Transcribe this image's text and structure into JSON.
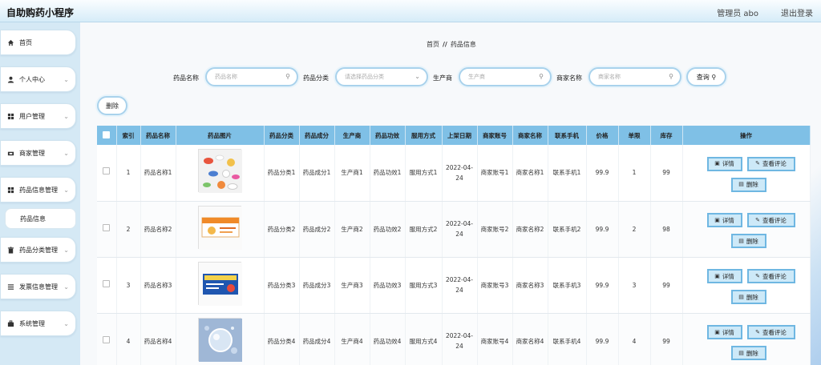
{
  "header": {
    "title": "自助购药小程序",
    "admin": "管理员 abo",
    "logout": "退出登录"
  },
  "sidebar": {
    "items": [
      {
        "label": "首页",
        "icon": "home-icon",
        "chevron": false
      },
      {
        "label": "个人中心",
        "icon": "user-icon",
        "chevron": true
      },
      {
        "label": "用户管理",
        "icon": "grid-icon",
        "chevron": true
      },
      {
        "label": "商家管理",
        "icon": "store-icon",
        "chevron": true
      },
      {
        "label": "药品信息管理",
        "icon": "grid-icon",
        "chevron": true
      },
      {
        "label": "药品分类管理",
        "icon": "trash-icon",
        "chevron": true
      },
      {
        "label": "发票信息管理",
        "icon": "list-icon",
        "chevron": true
      },
      {
        "label": "系统管理",
        "icon": "briefcase-icon",
        "chevron": true
      }
    ],
    "submenu": "药品信息"
  },
  "breadcrumb": {
    "home": "首页",
    "separator": "//",
    "current": "药品信息"
  },
  "search": {
    "name_label": "药品名称",
    "name_placeholder": "药品名称",
    "category_label": "药品分类",
    "category_placeholder": "请选择药品分类",
    "maker_label": "生产商",
    "maker_placeholder": "生产商",
    "merchant_label": "商家名称",
    "merchant_placeholder": "商家名称",
    "query_label": "查询"
  },
  "toolbar": {
    "delete_label": "删除"
  },
  "table": {
    "headers": [
      "索引",
      "药品名称",
      "药品图片",
      "药品分类",
      "药品成分",
      "生产商",
      "药品功效",
      "服用方式",
      "上架日期",
      "商家账号",
      "商家名称",
      "联系手机",
      "价格",
      "单限",
      "库存",
      "操作"
    ],
    "rows": [
      {
        "index": "1",
        "name": "药品名称1",
        "category": "药品分类1",
        "ingredient": "药品成分1",
        "maker": "生产商1",
        "effect": "药品功效1",
        "usage": "服用方式1",
        "date": "2022-04-24",
        "account": "商家账号1",
        "merchant": "商家名称1",
        "phone": "联系手机1",
        "price": "99.9",
        "limit": "1",
        "stock": "99"
      },
      {
        "index": "2",
        "name": "药品名称2",
        "category": "药品分类2",
        "ingredient": "药品成分2",
        "maker": "生产商2",
        "effect": "药品功效2",
        "usage": "服用方式2",
        "date": "2022-04-24",
        "account": "商家账号2",
        "merchant": "商家名称2",
        "phone": "联系手机2",
        "price": "99.9",
        "limit": "2",
        "stock": "98"
      },
      {
        "index": "3",
        "name": "药品名称3",
        "category": "药品分类3",
        "ingredient": "药品成分3",
        "maker": "生产商3",
        "effect": "药品功效3",
        "usage": "服用方式3",
        "date": "2022-04-24",
        "account": "商家账号3",
        "merchant": "商家名称3",
        "phone": "联系手机3",
        "price": "99.9",
        "limit": "3",
        "stock": "99"
      },
      {
        "index": "4",
        "name": "药品名称4",
        "category": "药品分类4",
        "ingredient": "药品成分4",
        "maker": "生产商4",
        "effect": "药品功效4",
        "usage": "服用方式4",
        "date": "2022-04-24",
        "account": "商家账号4",
        "merchant": "商家名称4",
        "phone": "联系手机4",
        "price": "99.9",
        "limit": "4",
        "stock": "99"
      }
    ],
    "actions": {
      "detail": "详情",
      "review": "查看评论",
      "delete": "删除"
    }
  },
  "colors": {
    "header_bg": "#d6ecf8",
    "table_header": "#7fc0e6",
    "button_border": "#6fb7e2",
    "button_bg": "#cde9f8"
  }
}
